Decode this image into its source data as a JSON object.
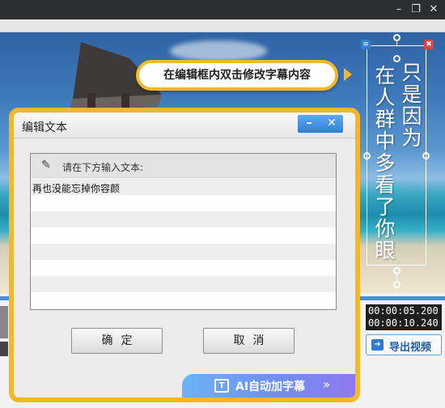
{
  "app": {
    "window_controls": {
      "minimize": "–",
      "restore": "❐",
      "close": "✕"
    }
  },
  "preview": {
    "hint_text": "在编辑框内双击修改字幕内容",
    "subtitle_col1": [
      "只",
      "是",
      "因",
      "为"
    ],
    "subtitle_col2": [
      "在",
      "人",
      "群",
      "中",
      "多",
      "看",
      "了",
      "你",
      "眼"
    ],
    "icons": {
      "list": "list-icon",
      "trash": "trash-icon"
    }
  },
  "player": {
    "time_current": "00:00:05.200",
    "time_total": "00:00:10.240",
    "export_label": "导出视频"
  },
  "dialog": {
    "title": "编辑文本",
    "min_label": "–",
    "close_label": "✕",
    "prompt": "请在下方输入文本:",
    "text_value": "再也没能忘掉你容颜",
    "ok_label": "确定",
    "cancel_label": "取消"
  },
  "ai_banner": {
    "label": "AI自动加字幕",
    "arrow": "»"
  },
  "colors": {
    "highlight": "#f5b72a",
    "accent_blue": "#2f7fd6",
    "titlebar": "#2b2d31"
  }
}
